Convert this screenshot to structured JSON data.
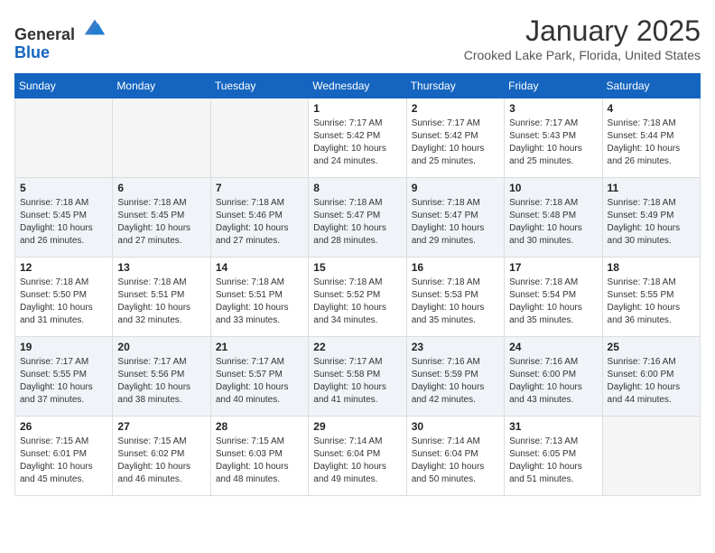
{
  "header": {
    "logo_general": "General",
    "logo_blue": "Blue",
    "month_title": "January 2025",
    "location": "Crooked Lake Park, Florida, United States"
  },
  "weekdays": [
    "Sunday",
    "Monday",
    "Tuesday",
    "Wednesday",
    "Thursday",
    "Friday",
    "Saturday"
  ],
  "weeks": [
    [
      {
        "day": "",
        "info": ""
      },
      {
        "day": "",
        "info": ""
      },
      {
        "day": "",
        "info": ""
      },
      {
        "day": "1",
        "info": "Sunrise: 7:17 AM\nSunset: 5:42 PM\nDaylight: 10 hours\nand 24 minutes."
      },
      {
        "day": "2",
        "info": "Sunrise: 7:17 AM\nSunset: 5:42 PM\nDaylight: 10 hours\nand 25 minutes."
      },
      {
        "day": "3",
        "info": "Sunrise: 7:17 AM\nSunset: 5:43 PM\nDaylight: 10 hours\nand 25 minutes."
      },
      {
        "day": "4",
        "info": "Sunrise: 7:18 AM\nSunset: 5:44 PM\nDaylight: 10 hours\nand 26 minutes."
      }
    ],
    [
      {
        "day": "5",
        "info": "Sunrise: 7:18 AM\nSunset: 5:45 PM\nDaylight: 10 hours\nand 26 minutes."
      },
      {
        "day": "6",
        "info": "Sunrise: 7:18 AM\nSunset: 5:45 PM\nDaylight: 10 hours\nand 27 minutes."
      },
      {
        "day": "7",
        "info": "Sunrise: 7:18 AM\nSunset: 5:46 PM\nDaylight: 10 hours\nand 27 minutes."
      },
      {
        "day": "8",
        "info": "Sunrise: 7:18 AM\nSunset: 5:47 PM\nDaylight: 10 hours\nand 28 minutes."
      },
      {
        "day": "9",
        "info": "Sunrise: 7:18 AM\nSunset: 5:47 PM\nDaylight: 10 hours\nand 29 minutes."
      },
      {
        "day": "10",
        "info": "Sunrise: 7:18 AM\nSunset: 5:48 PM\nDaylight: 10 hours\nand 30 minutes."
      },
      {
        "day": "11",
        "info": "Sunrise: 7:18 AM\nSunset: 5:49 PM\nDaylight: 10 hours\nand 30 minutes."
      }
    ],
    [
      {
        "day": "12",
        "info": "Sunrise: 7:18 AM\nSunset: 5:50 PM\nDaylight: 10 hours\nand 31 minutes."
      },
      {
        "day": "13",
        "info": "Sunrise: 7:18 AM\nSunset: 5:51 PM\nDaylight: 10 hours\nand 32 minutes."
      },
      {
        "day": "14",
        "info": "Sunrise: 7:18 AM\nSunset: 5:51 PM\nDaylight: 10 hours\nand 33 minutes."
      },
      {
        "day": "15",
        "info": "Sunrise: 7:18 AM\nSunset: 5:52 PM\nDaylight: 10 hours\nand 34 minutes."
      },
      {
        "day": "16",
        "info": "Sunrise: 7:18 AM\nSunset: 5:53 PM\nDaylight: 10 hours\nand 35 minutes."
      },
      {
        "day": "17",
        "info": "Sunrise: 7:18 AM\nSunset: 5:54 PM\nDaylight: 10 hours\nand 35 minutes."
      },
      {
        "day": "18",
        "info": "Sunrise: 7:18 AM\nSunset: 5:55 PM\nDaylight: 10 hours\nand 36 minutes."
      }
    ],
    [
      {
        "day": "19",
        "info": "Sunrise: 7:17 AM\nSunset: 5:55 PM\nDaylight: 10 hours\nand 37 minutes."
      },
      {
        "day": "20",
        "info": "Sunrise: 7:17 AM\nSunset: 5:56 PM\nDaylight: 10 hours\nand 38 minutes."
      },
      {
        "day": "21",
        "info": "Sunrise: 7:17 AM\nSunset: 5:57 PM\nDaylight: 10 hours\nand 40 minutes."
      },
      {
        "day": "22",
        "info": "Sunrise: 7:17 AM\nSunset: 5:58 PM\nDaylight: 10 hours\nand 41 minutes."
      },
      {
        "day": "23",
        "info": "Sunrise: 7:16 AM\nSunset: 5:59 PM\nDaylight: 10 hours\nand 42 minutes."
      },
      {
        "day": "24",
        "info": "Sunrise: 7:16 AM\nSunset: 6:00 PM\nDaylight: 10 hours\nand 43 minutes."
      },
      {
        "day": "25",
        "info": "Sunrise: 7:16 AM\nSunset: 6:00 PM\nDaylight: 10 hours\nand 44 minutes."
      }
    ],
    [
      {
        "day": "26",
        "info": "Sunrise: 7:15 AM\nSunset: 6:01 PM\nDaylight: 10 hours\nand 45 minutes."
      },
      {
        "day": "27",
        "info": "Sunrise: 7:15 AM\nSunset: 6:02 PM\nDaylight: 10 hours\nand 46 minutes."
      },
      {
        "day": "28",
        "info": "Sunrise: 7:15 AM\nSunset: 6:03 PM\nDaylight: 10 hours\nand 48 minutes."
      },
      {
        "day": "29",
        "info": "Sunrise: 7:14 AM\nSunset: 6:04 PM\nDaylight: 10 hours\nand 49 minutes."
      },
      {
        "day": "30",
        "info": "Sunrise: 7:14 AM\nSunset: 6:04 PM\nDaylight: 10 hours\nand 50 minutes."
      },
      {
        "day": "31",
        "info": "Sunrise: 7:13 AM\nSunset: 6:05 PM\nDaylight: 10 hours\nand 51 minutes."
      },
      {
        "day": "",
        "info": ""
      }
    ]
  ]
}
